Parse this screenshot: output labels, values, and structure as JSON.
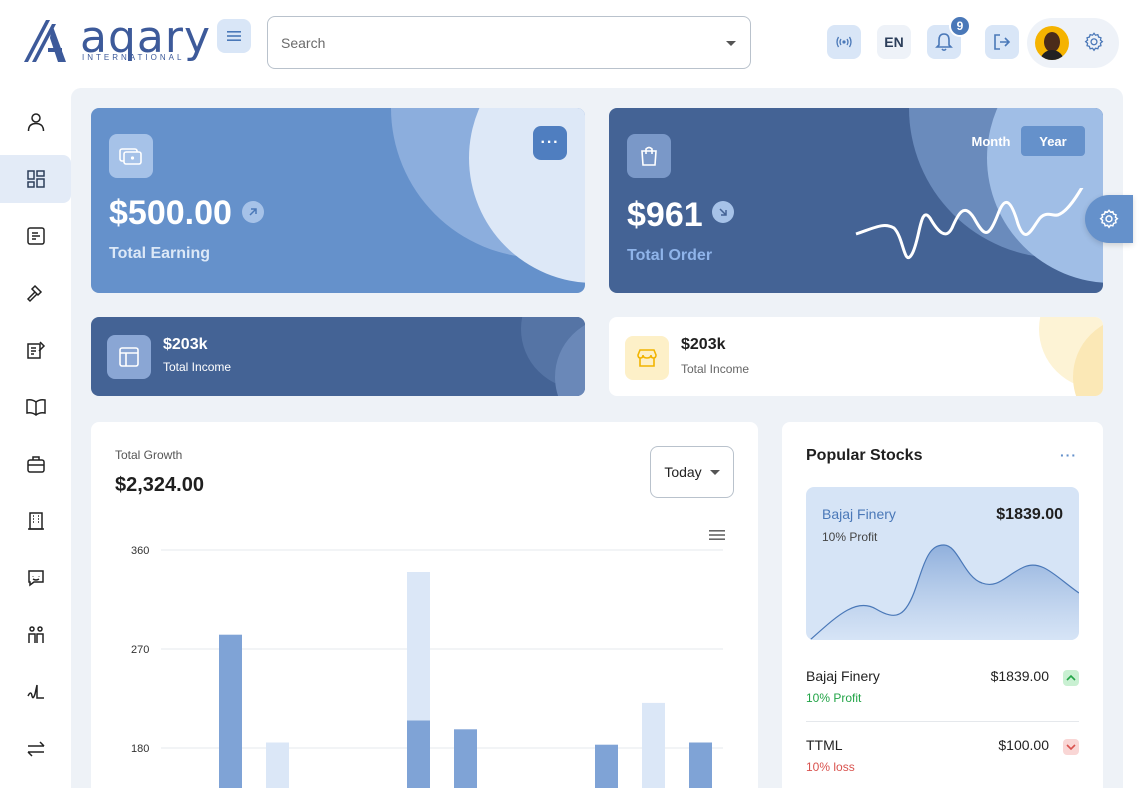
{
  "brand": {
    "name": "aqary",
    "tagline": "INTERNATIONAL"
  },
  "header": {
    "search_placeholder": "Search",
    "language": "EN",
    "notification_count": "9"
  },
  "sidebar": {
    "items": [
      {
        "icon": "user-icon"
      },
      {
        "icon": "dashboard-icon",
        "active": true
      },
      {
        "icon": "document-list-icon"
      },
      {
        "icon": "gavel-icon"
      },
      {
        "icon": "clipboard-edit-icon"
      },
      {
        "icon": "book-icon"
      },
      {
        "icon": "briefcase-icon"
      },
      {
        "icon": "building-icon"
      },
      {
        "icon": "chat-icon"
      },
      {
        "icon": "people-icon"
      },
      {
        "icon": "signature-icon"
      },
      {
        "icon": "transfer-icon"
      }
    ]
  },
  "cards": {
    "earning": {
      "amount": "$500.00",
      "label": "Total Earning"
    },
    "order": {
      "amount": "$961",
      "label": "Total Order",
      "toggle_month": "Month",
      "toggle_year": "Year",
      "selected": "Year"
    },
    "income_dark": {
      "amount": "$203k",
      "label": "Total Income"
    },
    "income_light": {
      "amount": "$203k",
      "label": "Total Income"
    }
  },
  "growth": {
    "title": "Total Growth",
    "value": "$2,324.00",
    "period": "Today"
  },
  "chart_data": {
    "type": "bar",
    "stacked": true,
    "yticks": [
      360,
      270,
      180
    ],
    "ylim": [
      0,
      360
    ],
    "series": [
      {
        "values": [
          0,
          283,
          0,
          0,
          0,
          0,
          0,
          0,
          0,
          0,
          0,
          0
        ]
      },
      {
        "values": [
          0,
          0,
          0,
          0,
          0,
          0,
          0,
          0,
          0,
          0,
          0,
          0
        ]
      }
    ],
    "bars": [
      {
        "x": 1,
        "dark": 283,
        "light": 0
      },
      {
        "x": 2,
        "dark": 0,
        "light": 185
      },
      {
        "x": 5,
        "dark": 205,
        "light": 135
      },
      {
        "x": 6,
        "dark": 197,
        "light": 0
      },
      {
        "x": 9,
        "dark": 183,
        "light": 0
      },
      {
        "x": 10,
        "dark": 0,
        "light": 221
      },
      {
        "x": 11,
        "dark": 185,
        "light": 0
      }
    ]
  },
  "stocks": {
    "title": "Popular Stocks",
    "featured": {
      "name": "Bajaj Finery",
      "sub": "10% Profit",
      "price": "$1839.00"
    },
    "rows": [
      {
        "name": "Bajaj Finery",
        "sub": "10% Profit",
        "price": "$1839.00",
        "trend": "up",
        "color": "#22a447"
      },
      {
        "name": "TTML",
        "sub": "10% loss",
        "price": "$100.00",
        "trend": "down",
        "color": "#d9534f"
      }
    ]
  },
  "colors": {
    "primary": "#6591cb",
    "dark": "#446395",
    "light": "#d6e4f6",
    "bar_dark": "#7fa3d6",
    "bar_light": "#dbe7f7"
  }
}
